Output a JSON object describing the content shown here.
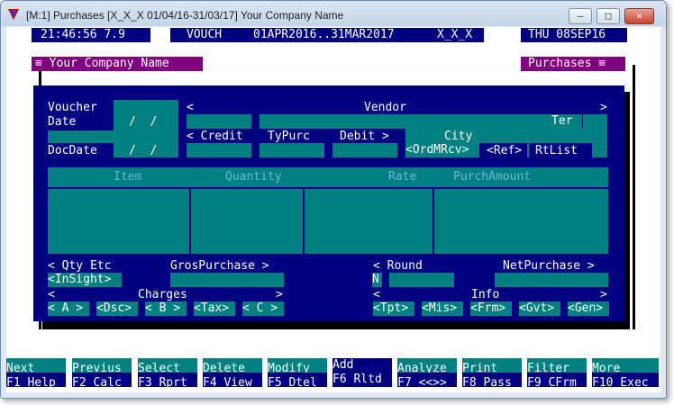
{
  "window": {
    "title": "[M:1]  Purchases  [X_X_X 01/04/16-31/03/17]  Your Company Name",
    "min_glyph": "–",
    "max_glyph": "□",
    "close_glyph": "✕"
  },
  "status": {
    "time": "21:46:56 7.9",
    "mode": "VOUCH",
    "period": "01APR2016..31MAR2017",
    "company_code": "X_X_X",
    "date": "THU 08SEP16"
  },
  "panels": {
    "company_title": "≡ Your Company Name",
    "module_title": "Purchases ≡"
  },
  "form": {
    "voucher_label": "Voucher",
    "date_label": "Date",
    "date_sep": "/  /",
    "docdate_label": "DocDate",
    "docdate_sep": "/  /",
    "vendor_left": "<",
    "vendor_label": "Vendor",
    "vendor_right": ">",
    "ter_label": "Ter",
    "credit_label": "< Credit",
    "typurc_label": "TyPurc",
    "debit_label": "Debit >",
    "city_label": "City",
    "ordmrcv_label": "<OrdMRcv>",
    "ref_label": "<Ref>",
    "rtlist_label": "RtList"
  },
  "grid": {
    "columns": [
      "Item",
      "Quantity",
      "Rate",
      "PurchAmount"
    ]
  },
  "totals": {
    "qty_etc_label": "< Qty Etc",
    "gros_label": "GrosPurchase >",
    "insight_label": "<InSight>",
    "round_label": "< Round",
    "netpurchase_label": "NetPurchase >",
    "round_flag": "N",
    "charges_left": "<",
    "charges_label": "Charges",
    "charges_right": ">",
    "info_left": "<",
    "info_label": "Info",
    "info_right": ">",
    "charge_buttons": [
      "< A >",
      "<Dsc>",
      "< B >",
      "<Tax>",
      "< C >"
    ],
    "info_buttons": [
      "<Tpt>",
      "<Mis>",
      "<Frm>",
      "<Gvt>",
      "<Gen>"
    ]
  },
  "function_keys": [
    {
      "top": "Next",
      "bottom": "F1 Help"
    },
    {
      "top": "Previus",
      "bottom": "F2 Calc"
    },
    {
      "top": "Select",
      "bottom": "F3 Rprt"
    },
    {
      "top": "Delete",
      "bottom": "F4 View"
    },
    {
      "top": "Modify",
      "bottom": "F5 Dtel"
    },
    {
      "top": "Add",
      "bottom": "F6 Rltd"
    },
    {
      "top": "Analyze",
      "bottom": "F7 <<>>"
    },
    {
      "top": "Print",
      "bottom": "F8 Pass"
    },
    {
      "top": "Filter",
      "bottom": "F9 CFrm"
    },
    {
      "top": "More",
      "bottom": "F10 Exec"
    }
  ]
}
